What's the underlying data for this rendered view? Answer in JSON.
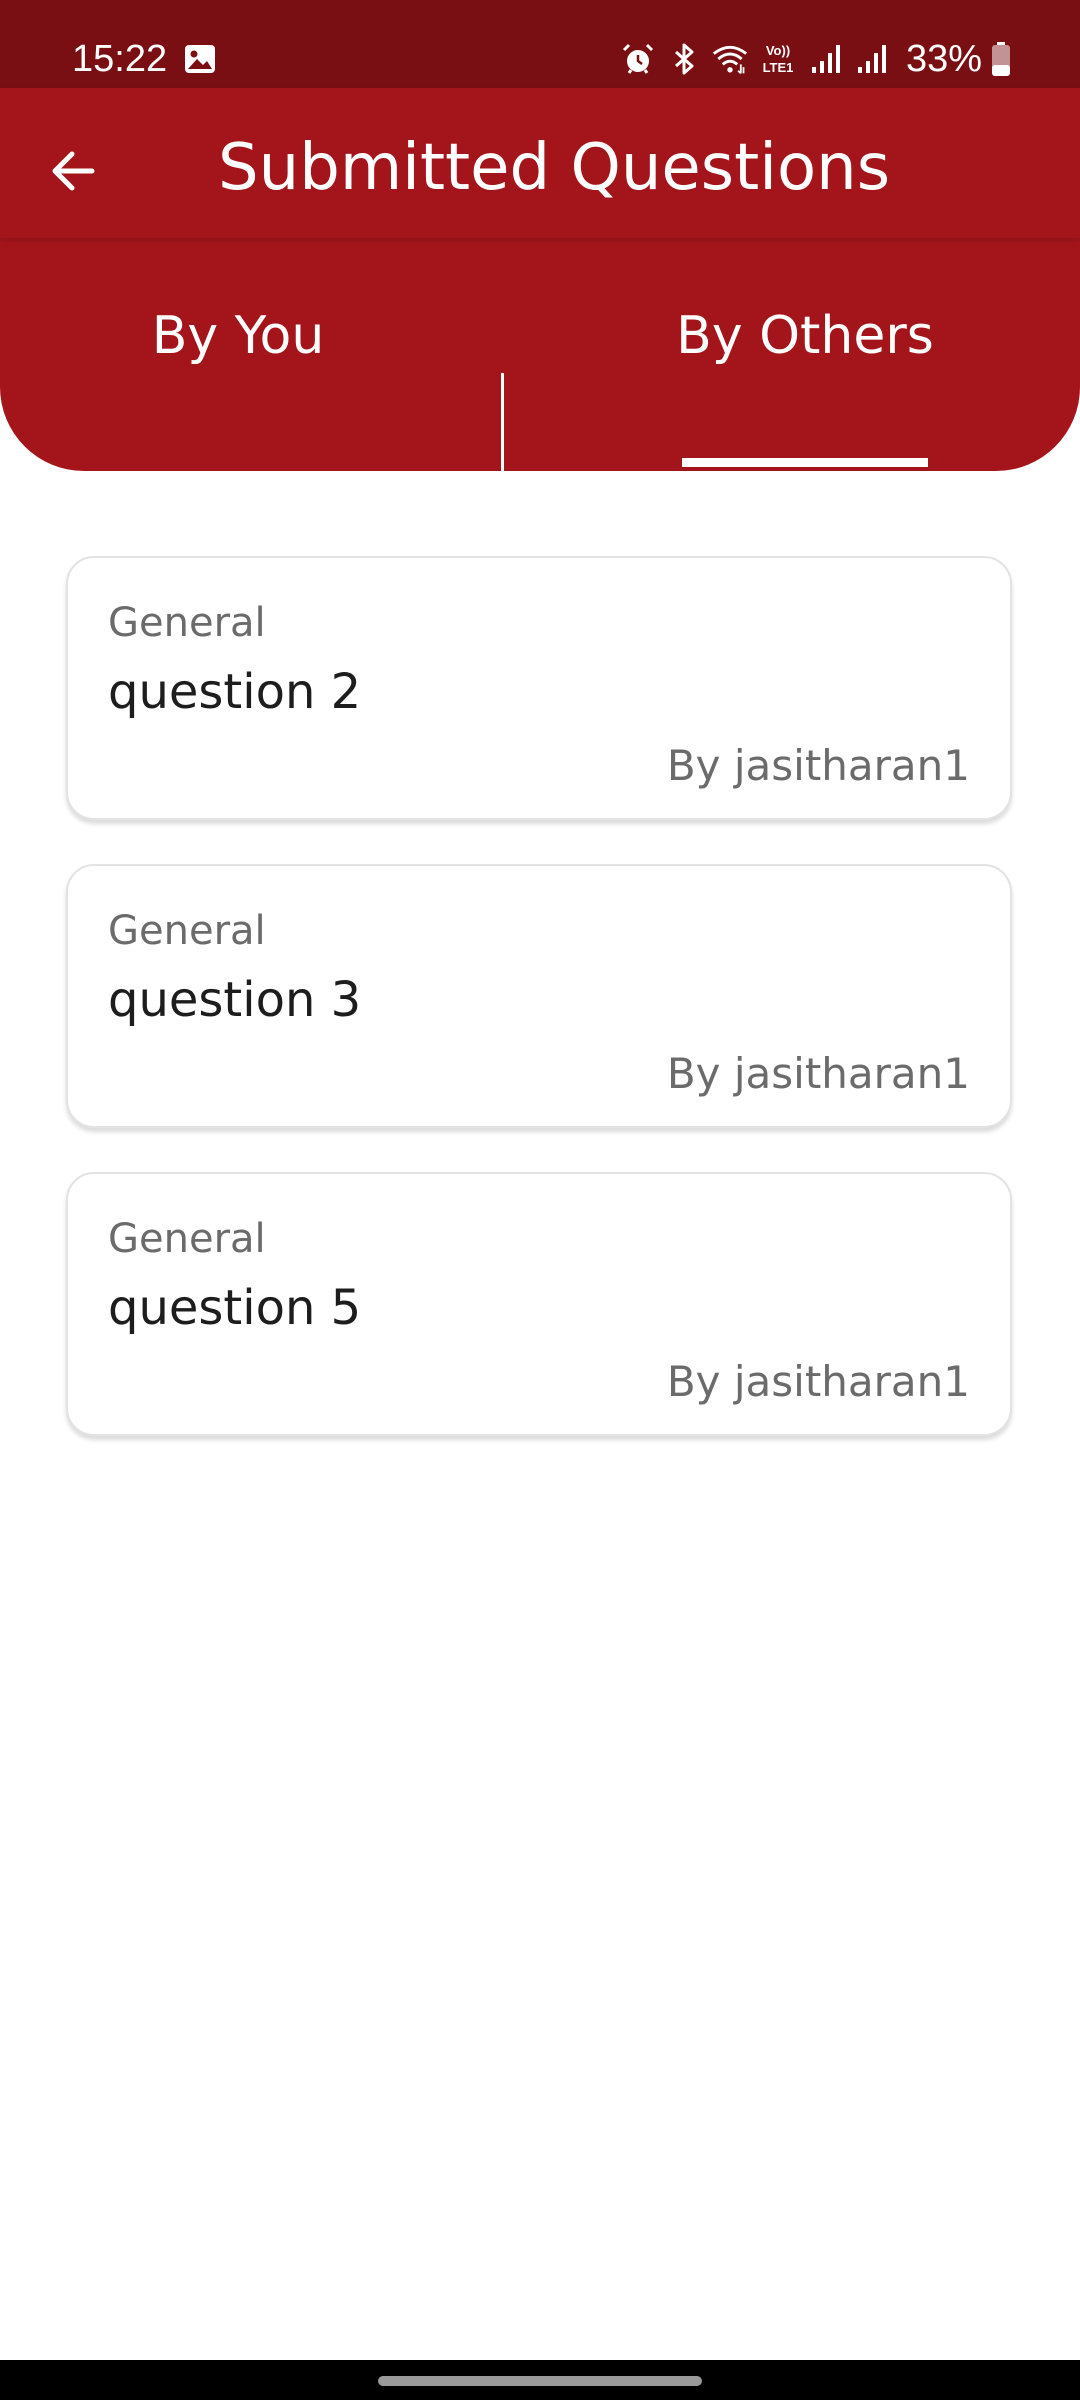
{
  "status_bar": {
    "time": "15:22",
    "battery_percent": "33%",
    "icons": [
      "gallery-icon",
      "alarm-icon",
      "bluetooth-icon",
      "wifi-icon",
      "volte-icon",
      "signal-icon",
      "signal-icon",
      "battery-icon"
    ],
    "volte_label": "Vo)) LTE1"
  },
  "app_bar": {
    "title": "Submitted Questions",
    "back_icon": "arrow-left-icon"
  },
  "tabs": [
    {
      "label": "By You",
      "selected": false
    },
    {
      "label": "By Others",
      "selected": true
    }
  ],
  "questions": [
    {
      "category": "General",
      "question": "question 2",
      "author": "By jasitharan1"
    },
    {
      "category": "General",
      "question": "question 3",
      "author": "By jasitharan1"
    },
    {
      "category": "General",
      "question": "question 5",
      "author": "By jasitharan1"
    }
  ],
  "colors": {
    "status_bar": "#7a0f13",
    "header": "#a4151b",
    "text_on_header": "#ffffff",
    "muted_text": "#6b6b6b"
  }
}
